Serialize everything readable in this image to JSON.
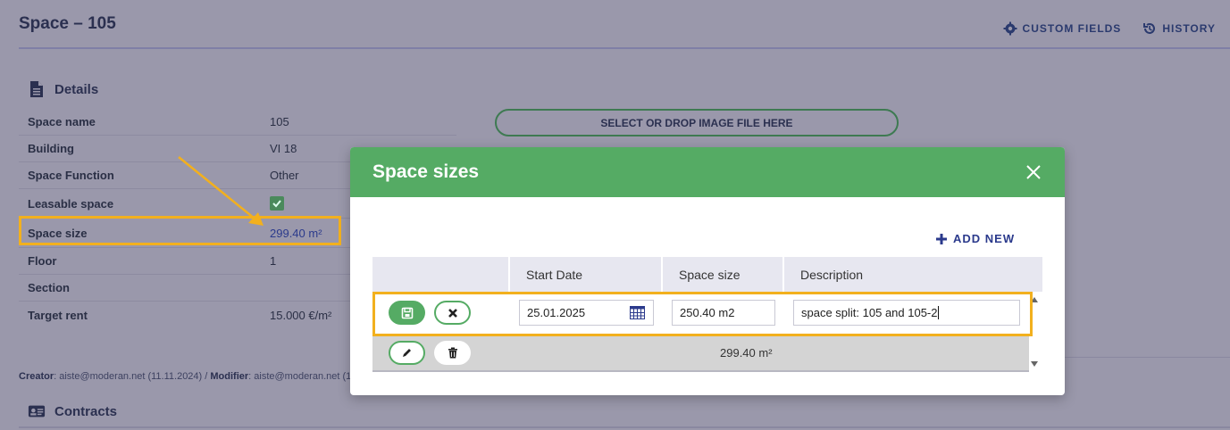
{
  "page": {
    "title": "Space – 105",
    "actions": [
      "CUSTOM FIELDS",
      "HISTORY"
    ]
  },
  "details": {
    "title": "Details",
    "rows": [
      {
        "label": "Space name",
        "value": "105"
      },
      {
        "label": "Building",
        "value": "VI 18"
      },
      {
        "label": "Space Function",
        "value": "Other"
      },
      {
        "label": "Leasable space",
        "value": ""
      },
      {
        "label": "Space size",
        "value": "299.40 m²"
      },
      {
        "label": "Floor",
        "value": "1"
      },
      {
        "label": "Section",
        "value": ""
      },
      {
        "label": "Target rent",
        "value": "15.000 €/m²"
      }
    ],
    "leasable_checked": true
  },
  "upload": {
    "label": "SELECT OR DROP IMAGE FILE HERE"
  },
  "meta": {
    "creator_label": "Creator",
    "creator_value": ": aiste@moderan.net (11.11.2024) / ",
    "modifier_label": "Modifier",
    "modifier_value": ": aiste@moderan.net (1"
  },
  "contracts": {
    "title": "Contracts"
  },
  "modal": {
    "title": "Space sizes",
    "add_new": "ADD NEW",
    "columns": [
      "",
      "Start Date",
      "Space size",
      "Description"
    ],
    "edit_row": {
      "start_date": "25.01.2025",
      "space_size": "250.40 m2",
      "description": "space split: 105 and 105-2"
    },
    "data_row": {
      "space_size": "299.40 m²"
    }
  },
  "colors": {
    "accent_green": "#55ab64",
    "highlight": "#f2b01e",
    "link_blue": "#2b3a8c"
  }
}
